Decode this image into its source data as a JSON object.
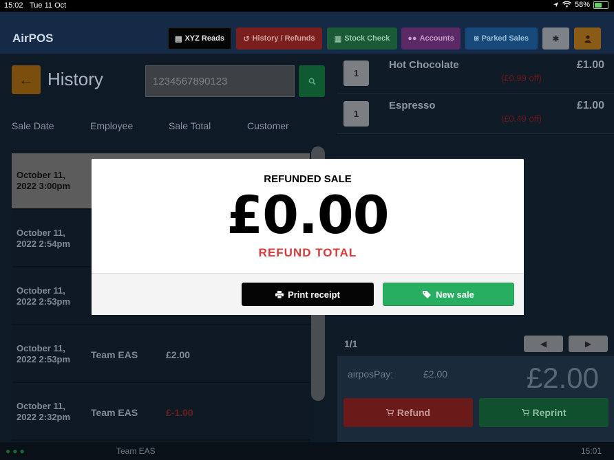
{
  "status_bar": {
    "time": "15:02",
    "date": "Tue 11 Oct",
    "battery": "58%",
    "battery_level": 0.58
  },
  "nav": {
    "brand": "AirPOS",
    "xyz_reads": "XYZ Reads",
    "history_refunds": "History / Refunds",
    "stock_check": "Stock Check",
    "accounts": "Accounts",
    "parked_sales": "Parked Sales",
    "icons": {
      "settings": "gear-icon",
      "user": "user-icon"
    }
  },
  "history": {
    "title": "History",
    "search_value": "1234567890123",
    "columns": [
      "Sale Date",
      "Employee",
      "Sale Total",
      "Customer"
    ],
    "rows": [
      {
        "date_line1": "October 11,",
        "date_line2": "2022 3:00pm",
        "employee": "",
        "total": ""
      },
      {
        "date_line1": "October 11,",
        "date_line2": "2022 2:54pm",
        "employee": "",
        "total": ""
      },
      {
        "date_line1": "October 11,",
        "date_line2": "2022 2:53pm",
        "employee": "",
        "total": ""
      },
      {
        "date_line1": "October 11,",
        "date_line2": "2022 2:53pm",
        "employee": "Team EAS",
        "total": "£2.00"
      },
      {
        "date_line1": "October 11,",
        "date_line2": "2022 2:32pm",
        "employee": "Team EAS",
        "total": "£-1.00"
      }
    ]
  },
  "sale": {
    "items": [
      {
        "qty": "1",
        "name": "Hot Chocolate",
        "price": "£1.00",
        "discount": "(£0.99 off)"
      },
      {
        "qty": "1",
        "name": "Espresso",
        "price": "£1.00",
        "discount": "(£0.49 off)"
      }
    ],
    "page": "1/1",
    "payment_label": "airposPay:",
    "payment_amount": "£2.00",
    "total": "£2.00",
    "refund_label": "Refund",
    "reprint_label": "Reprint"
  },
  "bottom_bar": {
    "employee": "Team EAS",
    "time": "15:01"
  },
  "modal": {
    "label": "REFUNDED SALE",
    "amount": "£0.00",
    "subtitle": "REFUND TOTAL",
    "print_label": "Print receipt",
    "new_sale_label": "New sale"
  },
  "colors": {
    "accent_red": "#d63a3a",
    "accent_green": "#27ae60",
    "nav_bg": "#142a47"
  }
}
